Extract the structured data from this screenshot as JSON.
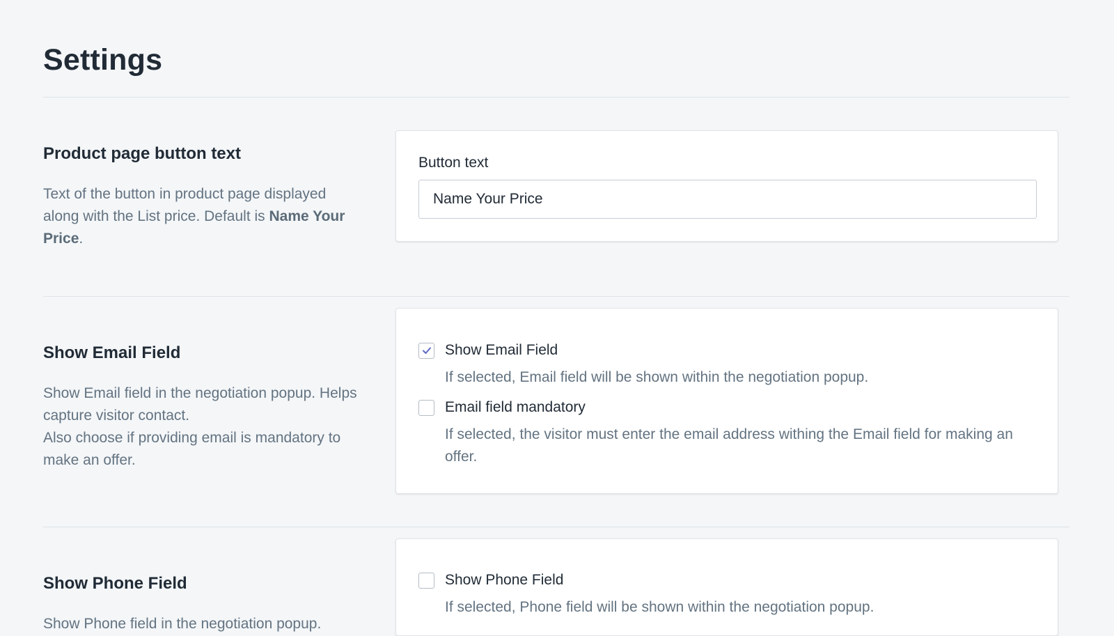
{
  "page": {
    "title": "Settings"
  },
  "sections": [
    {
      "heading": "Product page button text",
      "description_prefix": "Text of the button in product page displayed along with the List price. Default is ",
      "description_bold": "Name Your Price",
      "description_suffix": ".",
      "field_label": "Button text",
      "field_value": "Name Your Price"
    },
    {
      "heading": "Show Email Field",
      "description_line1": "Show Email field in the negotiation popup. Helps capture visitor contact.",
      "description_line2": "Also choose if providing email is mandatory to make an offer.",
      "options": [
        {
          "label": "Show Email Field",
          "checked": true,
          "help": "If selected, Email field will be shown within the negotiation popup."
        },
        {
          "label": "Email field mandatory",
          "checked": false,
          "help": "If selected, the visitor must enter the email address withing the Email field for making an offer."
        }
      ]
    },
    {
      "heading": "Show Phone Field",
      "description_line1": "Show Phone field in the negotiation popup.",
      "options": [
        {
          "label": "Show Phone Field",
          "checked": false,
          "help": "If selected, Phone field will be shown within the negotiation popup."
        }
      ]
    }
  ],
  "colors": {
    "background": "#f4f6f8",
    "check_accent": "#5c6ac4"
  }
}
